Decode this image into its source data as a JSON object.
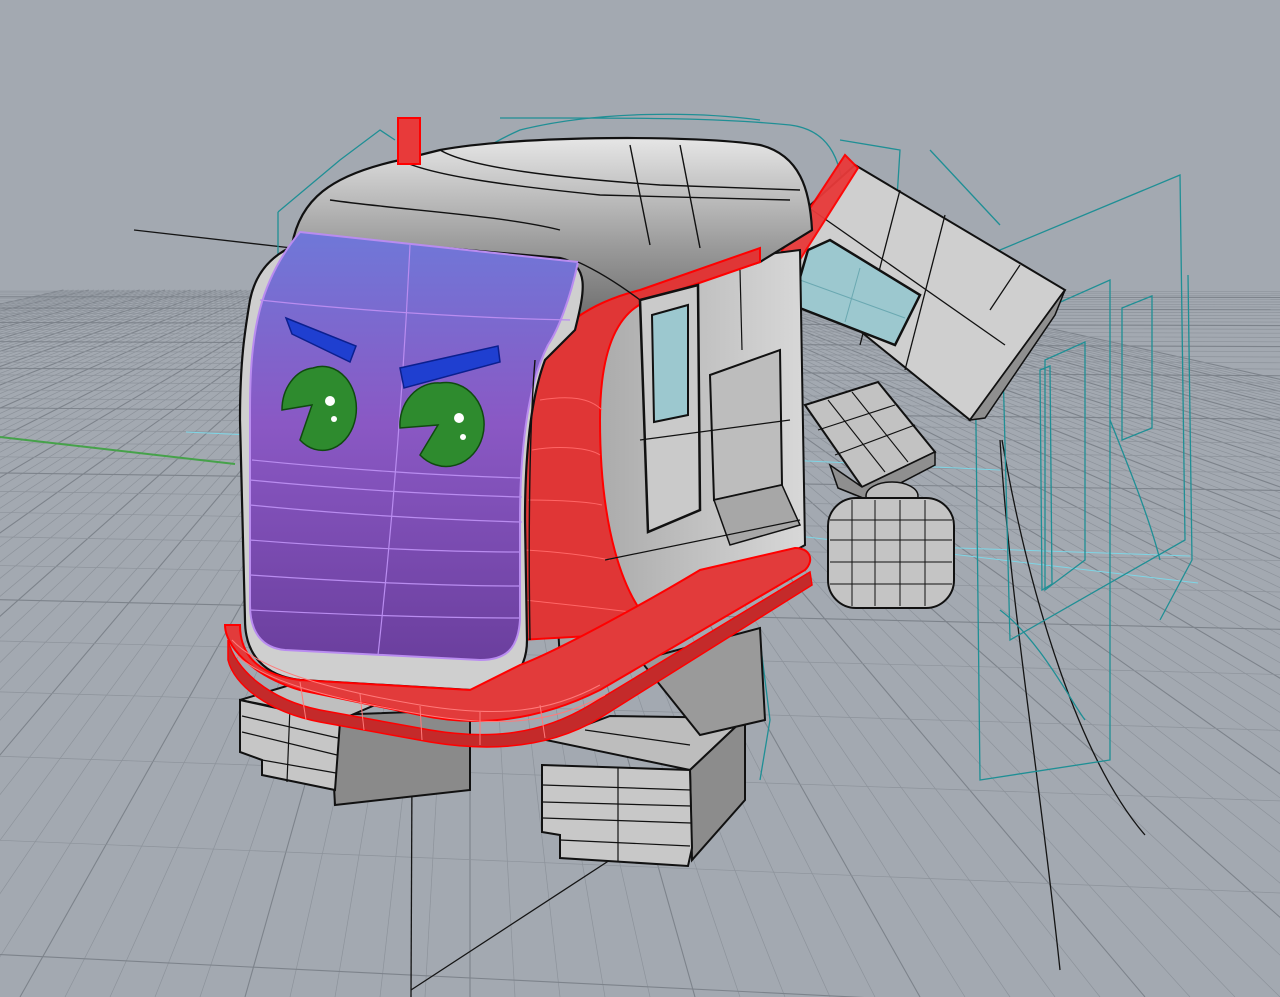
{
  "viewport": {
    "background": "#a3a9b1",
    "grid_color": "#8d939b",
    "grid_major_color": "#7d838b",
    "x_axis_color": "#46a24a",
    "construction_line_color": "#7ed6e6",
    "wireframe_color": "#1f8f95",
    "curve_color": "#141414"
  },
  "model": {
    "body_color": "#c9c9c9",
    "body_shadow_color": "#8e8e8e",
    "selected_color": "#ff0000",
    "visor_color": "#8a5ac8",
    "visor_highlight_color": "#b98cf0",
    "brow_color": "#1f3fd0",
    "eye_color": "#2e8b2e",
    "window_color": "#9cc8cf",
    "joint_color": "#bdbdbd"
  }
}
